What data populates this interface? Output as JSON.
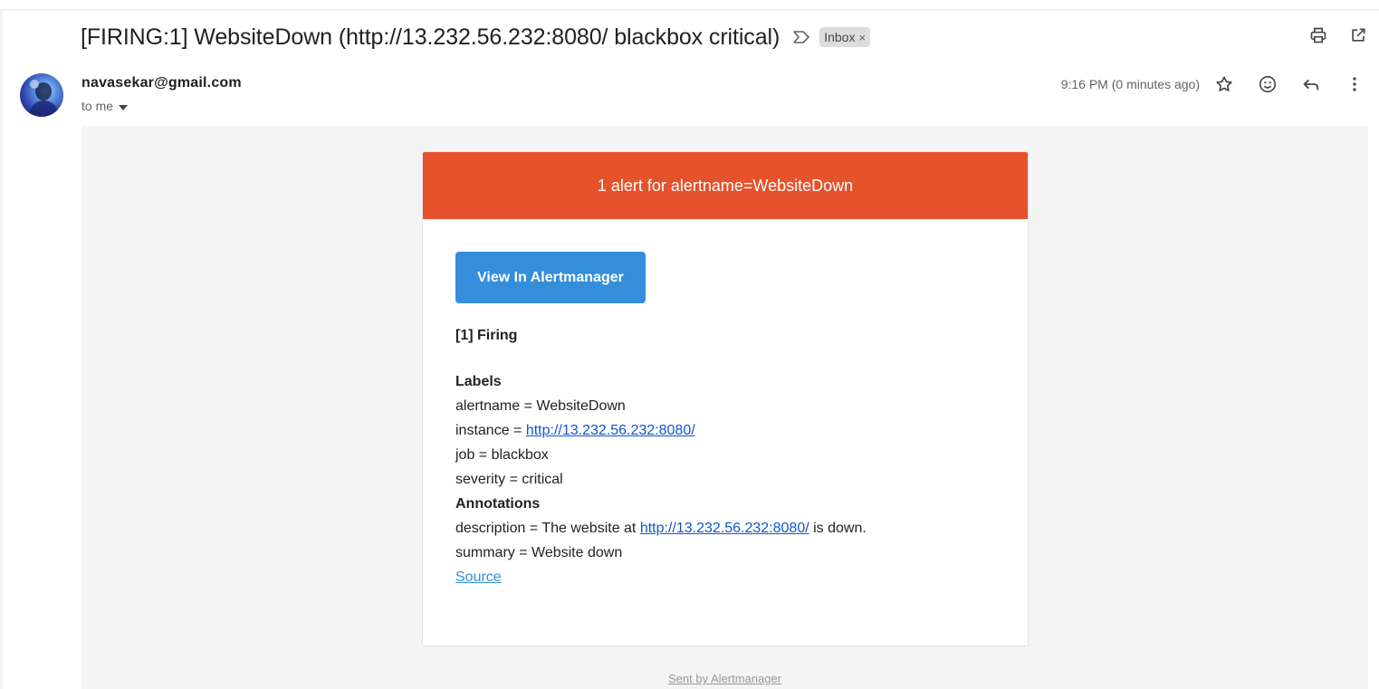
{
  "email": {
    "subject": "[FIRING:1] WebsiteDown (http://13.232.56.232:8080/ blackbox critical)",
    "label_chip": "Inbox",
    "label_chip_remove": "×",
    "sender": "navasekar@gmail.com",
    "recipient_line": "to me",
    "timestamp": "9:16 PM (0 minutes ago)"
  },
  "icons": {
    "importance": "importance-marker-icon",
    "print": "print-icon",
    "open_new_window": "open-in-new-icon",
    "star": "star-icon",
    "emoji": "emoji-icon",
    "reply": "reply-icon",
    "more": "more-vert-icon",
    "dropdown": "chevron-down-icon"
  },
  "alert": {
    "header": "1 alert for alertname=WebsiteDown",
    "button_label": "View In Alertmanager",
    "firing_title": "[1] Firing",
    "labels_title": "Labels",
    "labels": {
      "alertname": "alertname = WebsiteDown",
      "instance_prefix": "instance = ",
      "instance_link": "http://13.232.56.232:8080/",
      "job": "job = blackbox",
      "severity": "severity = critical"
    },
    "annotations_title": "Annotations",
    "annotations": {
      "description_prefix": "description = The website at ",
      "description_link": "http://13.232.56.232:8080/",
      "description_suffix": " is down.",
      "summary": "summary = Website down"
    },
    "source_link": "Source",
    "footer": "Sent by Alertmanager"
  },
  "colors": {
    "alert_header": "#e6522c",
    "button": "#348eda",
    "body_background": "#f4f4f4",
    "link": "#1155cc"
  }
}
